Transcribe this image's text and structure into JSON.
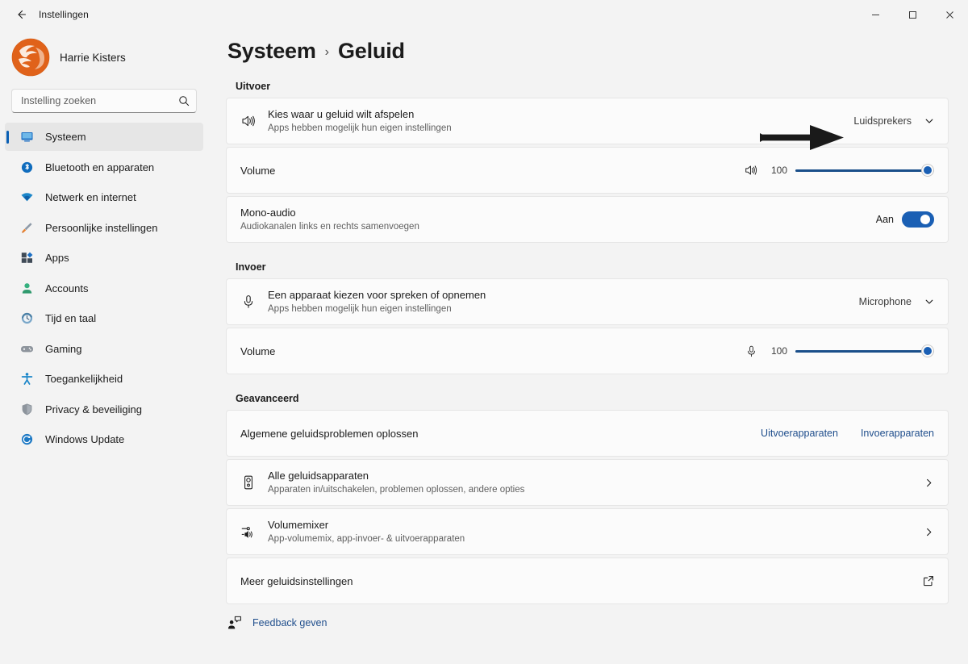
{
  "window": {
    "title": "Instellingen",
    "back_icon": "back-arrow-icon",
    "minimize_label": "–",
    "maximize_label": "□",
    "close_label": "×"
  },
  "sidebar": {
    "account": {
      "name": "Harrie Kisters",
      "avatar_icon": "user-avatar-logo"
    },
    "search": {
      "placeholder": "Instelling zoeken",
      "value": "",
      "icon": "search-icon"
    },
    "items": [
      {
        "label": "Systeem",
        "icon": "monitor-icon",
        "selected": true
      },
      {
        "label": "Bluetooth en apparaten",
        "icon": "bluetooth-icon",
        "selected": false
      },
      {
        "label": "Netwerk en internet",
        "icon": "wifi-icon",
        "selected": false
      },
      {
        "label": "Persoonlijke instellingen",
        "icon": "paintbrush-icon",
        "selected": false
      },
      {
        "label": "Apps",
        "icon": "apps-icon",
        "selected": false
      },
      {
        "label": "Accounts",
        "icon": "person-icon",
        "selected": false
      },
      {
        "label": "Tijd en taal",
        "icon": "clock-globe-icon",
        "selected": false
      },
      {
        "label": "Gaming",
        "icon": "gamepad-icon",
        "selected": false
      },
      {
        "label": "Toegankelijkheid",
        "icon": "accessibility-icon",
        "selected": false
      },
      {
        "label": "Privacy & beveiliging",
        "icon": "shield-icon",
        "selected": false
      },
      {
        "label": "Windows Update",
        "icon": "update-icon",
        "selected": false
      }
    ]
  },
  "page": {
    "breadcrumb_root": "Systeem",
    "breadcrumb_separator": "›",
    "breadcrumb_current": "Geluid"
  },
  "output_section": {
    "heading": "Uitvoer",
    "device": {
      "title": "Kies waar u geluid wilt afspelen",
      "subtitle": "Apps hebben mogelijk hun eigen instellingen",
      "icon": "speaker-icon",
      "selected_value": "Luidsprekers",
      "chevron_icon": "chevron-down-icon"
    },
    "volume": {
      "title": "Volume",
      "icon": "speaker-icon",
      "value": "100",
      "percent": 100
    },
    "mono": {
      "title": "Mono-audio",
      "subtitle": "Audiokanalen links en rechts samenvoegen",
      "toggle_state_label": "Aan",
      "toggle_on": true
    }
  },
  "input_section": {
    "heading": "Invoer",
    "device": {
      "title": "Een apparaat kiezen voor spreken of opnemen",
      "subtitle": "Apps hebben mogelijk hun eigen instellingen",
      "icon": "microphone-icon",
      "selected_value": "Microphone",
      "chevron_icon": "chevron-down-icon"
    },
    "volume": {
      "title": "Volume",
      "icon": "microphone-icon",
      "value": "100",
      "percent": 100
    }
  },
  "advanced_section": {
    "heading": "Geavanceerd",
    "troubleshoot": {
      "title": "Algemene geluidsproblemen oplossen",
      "link_output": "Uitvoerapparaten",
      "link_input": "Invoerapparaten"
    },
    "all_devices": {
      "title": "Alle geluidsapparaten",
      "subtitle": "Apparaten in/uitschakelen, problemen oplossen, andere opties",
      "icon": "speaker-box-icon",
      "chevron_icon": "chevron-right-icon"
    },
    "volume_mixer": {
      "title": "Volumemixer",
      "subtitle": "App-volumemix, app-invoer- & uitvoerapparaten",
      "icon": "volume-mixer-icon",
      "chevron_icon": "chevron-right-icon"
    },
    "more_settings": {
      "title": "Meer geluidsinstellingen",
      "icon": "open-external-icon"
    }
  },
  "footer": {
    "feedback_label": "Feedback geven",
    "feedback_icon": "feedback-icon"
  },
  "annotation": {
    "arrow_icon": "pointer-arrow-annotation",
    "color": "#1a1a1a"
  },
  "colors": {
    "accent": "#1a5fb4",
    "link": "#1f4e8c",
    "page_background": "#f3f3f3",
    "card_background": "#fbfbfb"
  }
}
